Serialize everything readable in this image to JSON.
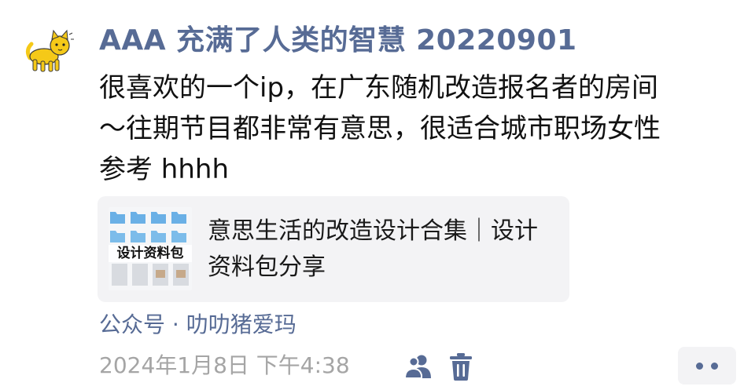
{
  "post": {
    "author": "AAA 充满了人类的智慧 20220901",
    "text_lines": [
      "很喜欢的一个ip，在广东随机改造报名者的房间",
      "～往期节目都非常有意思，很适合城市职场女性",
      "参考 hhhh"
    ],
    "link_card": {
      "title": "意思生活的改造设计合集｜设计资料包分享",
      "thumbnail_text": "设计资料包"
    },
    "source": "公众号 · 叻叻猪爱玛",
    "timestamp": "2024年1月8日 下午4:38",
    "icons": {
      "avatar": "yellow-cat-avatar",
      "visibility": "people-icon",
      "delete": "trash-icon",
      "more": "more-dots-icon"
    },
    "colors": {
      "link_blue": "#576b95",
      "text": "#111111",
      "muted": "#a5a5a5",
      "card_bg": "#f3f3f5",
      "avatar_yellow": "#f5c918"
    }
  }
}
